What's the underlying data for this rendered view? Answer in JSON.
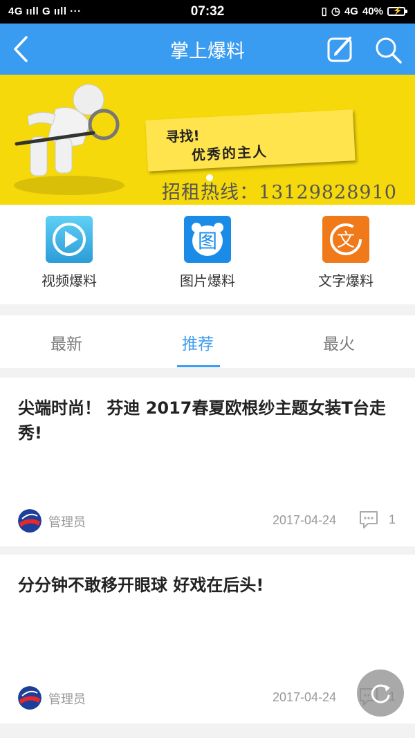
{
  "status_bar": {
    "signals": "4G ııll G ııll ···",
    "time": "07:32",
    "right_text": "4G",
    "battery": "40%"
  },
  "header": {
    "title": "掌上爆料",
    "back_icon": "chevron-left-icon",
    "edit_icon": "edit-icon",
    "search_icon": "search-icon"
  },
  "banner": {
    "sign_line1": "寻找!",
    "sign_line2": "优秀的主人",
    "hotline": "招租热线：13129828910"
  },
  "quick_actions": [
    {
      "label": "视频爆料",
      "icon": "play-icon",
      "color": "#3db4e8"
    },
    {
      "label": "图片爆料",
      "icon": "image-icon",
      "color": "#1a8ce8"
    },
    {
      "label": "文字爆料",
      "icon": "text-icon",
      "color": "#f07a1a"
    }
  ],
  "tabs": [
    {
      "label": "最新"
    },
    {
      "label": "推荐",
      "active": true
    },
    {
      "label": "最火"
    }
  ],
  "posts": [
    {
      "title": "尖端时尚！ 芬迪 2017春夏欧根纱主题女装T台走秀!",
      "author": "管理员",
      "date": "2017-04-24",
      "comments": "1"
    },
    {
      "title": "分分钟不敢移开眼球 好戏在后头!",
      "author": "管理员",
      "date": "2017-04-24",
      "comments": "1"
    }
  ],
  "colors": {
    "accent": "#3a9cf0",
    "banner": "#f5d90a"
  }
}
